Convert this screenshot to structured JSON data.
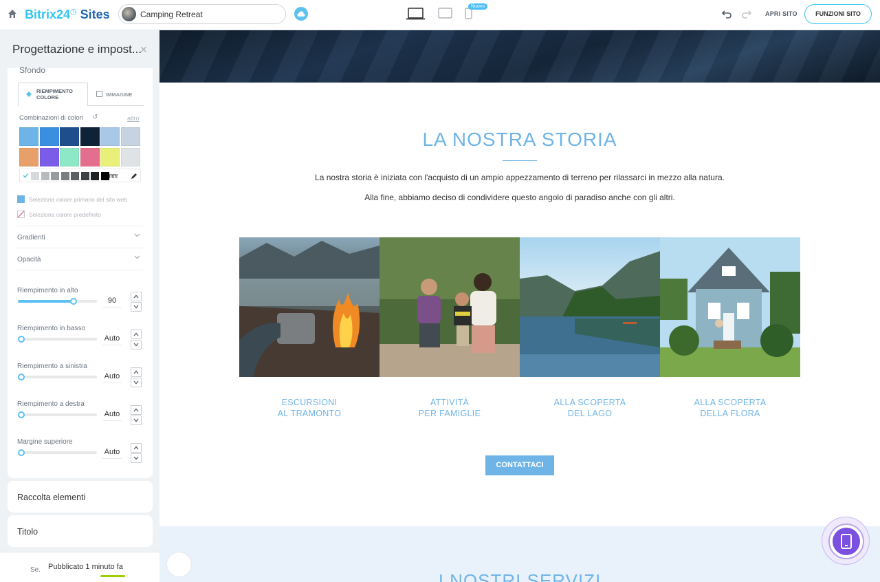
{
  "topbar": {
    "brand_part1": "Bitrix24",
    "brand_part2": "Sites",
    "site_name": "Camping Retreat",
    "badge_new": "Nuovo",
    "open_site": "APRI SITO",
    "site_functions": "FUNZIONI SITO"
  },
  "panel": {
    "title": "Progettazione e impost...",
    "section_label": "Sfondo",
    "tab_fill": "RIEMPIMENTO COLORE",
    "tab_image": "IMMAGINE",
    "combo_label": "Combinazioni di colori",
    "more_link": "altro",
    "swatch_colors": [
      "#6fb4e6",
      "#3b8fe0",
      "#1e4f8c",
      "#0e2238",
      "#a9c8e8",
      "#c6d3e0",
      "#e8a06a",
      "#7a5ce8",
      "#8de8c8",
      "#e36f8c",
      "#e8f07a",
      "#e0e3e6"
    ],
    "gray_colors": [
      "#d6d8da",
      "#b8bbbe",
      "#999c9f",
      "#7b7e81",
      "#5d6063",
      "#3e4144",
      "#1f2225",
      "#000000"
    ],
    "hex_value": "#ffffff",
    "option_primary": "Seleziona colore primario del sito web",
    "option_default": "Seleziona colore predefinito",
    "accordion_gradients": "Gradienti",
    "accordion_opacity": "Opacità",
    "sliders": [
      {
        "label": "Riempimento in alto",
        "value": "90",
        "level": 0.7
      },
      {
        "label": "Riempimento in basso",
        "value": "Auto",
        "level": 0
      },
      {
        "label": "Riempimento a sinistra",
        "value": "Auto",
        "level": 0
      },
      {
        "label": "Riempimento a destra",
        "value": "Auto",
        "level": 0
      },
      {
        "label": "Margine superiore",
        "value": "Auto",
        "level": 0
      }
    ],
    "section_elements": "Raccolta elementi",
    "section_title": "Titolo",
    "bottom_short": "Se.",
    "published": "Pubblicato 1 minuto fa"
  },
  "preview": {
    "story_title": "LA NOSTRA STORIA",
    "story_p1": "La nostra storia è iniziata con l'acquisto di un ampio appezzamento di terreno per rilassarci in mezzo alla natura.",
    "story_p2": "Alla fine, abbiamo deciso di condividere questo angolo di paradiso anche con gli altri.",
    "cards": [
      {
        "line1": "ESCURSIONI",
        "line2": "AL TRAMONTO"
      },
      {
        "line1": "ATTIVITÀ",
        "line2": "PER FAMIGLIE"
      },
      {
        "line1": "ALLA SCOPERTA",
        "line2": "DEL LAGO"
      },
      {
        "line1": "ALLA SCOPERTA",
        "line2": "DELLA FLORA"
      }
    ],
    "contact_button": "CONTATTACI",
    "services_title": "I NOSTRI SERVIZI"
  },
  "colors": {
    "accent": "#6fb4e6",
    "brand_blue": "#2067b0",
    "brand_cyan": "#2fc6f6",
    "fab_purple": "#7b4fe0",
    "published_green": "#9dcf00"
  }
}
